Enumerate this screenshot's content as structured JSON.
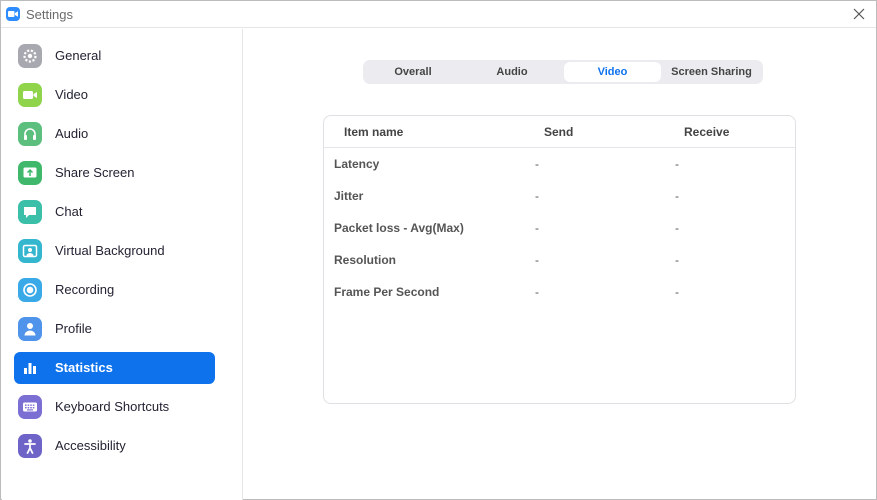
{
  "window": {
    "title": "Settings"
  },
  "sidebar": {
    "items": [
      {
        "label": "General",
        "icon": "gear-icon",
        "color": "#a8a8b0"
      },
      {
        "label": "Video",
        "icon": "video-camera-icon",
        "color": "#8fd44b"
      },
      {
        "label": "Audio",
        "icon": "headphones-icon",
        "color": "#5cbf7e"
      },
      {
        "label": "Share Screen",
        "icon": "share-screen-icon",
        "color": "#3fb86b"
      },
      {
        "label": "Chat",
        "icon": "chat-bubble-icon",
        "color": "#3bbfa9"
      },
      {
        "label": "Virtual Background",
        "icon": "virtual-background-icon",
        "color": "#34b6cf"
      },
      {
        "label": "Recording",
        "icon": "record-icon",
        "color": "#3aa9e8"
      },
      {
        "label": "Profile",
        "icon": "person-icon",
        "color": "#4f93ea"
      },
      {
        "label": "Statistics",
        "icon": "bar-chart-icon",
        "color": "#0e72ed",
        "active": true
      },
      {
        "label": "Keyboard Shortcuts",
        "icon": "keyboard-icon",
        "color": "#7b6fd4"
      },
      {
        "label": "Accessibility",
        "icon": "accessibility-icon",
        "color": "#6e64c8"
      }
    ]
  },
  "tabs": {
    "items": [
      "Overall",
      "Audio",
      "Video",
      "Screen Sharing"
    ],
    "selected": "Video"
  },
  "stats_table": {
    "headers": [
      "Item name",
      "Send",
      "Receive"
    ],
    "rows": [
      {
        "name": "Latency",
        "send": "-",
        "receive": "-"
      },
      {
        "name": "Jitter",
        "send": "-",
        "receive": "-"
      },
      {
        "name": "Packet loss - Avg(Max)",
        "send": "-",
        "receive": "-"
      },
      {
        "name": "Resolution",
        "send": "-",
        "receive": "-"
      },
      {
        "name": "Frame Per Second",
        "send": "-",
        "receive": "-"
      }
    ]
  },
  "colors": {
    "accent": "#0e72ed"
  }
}
